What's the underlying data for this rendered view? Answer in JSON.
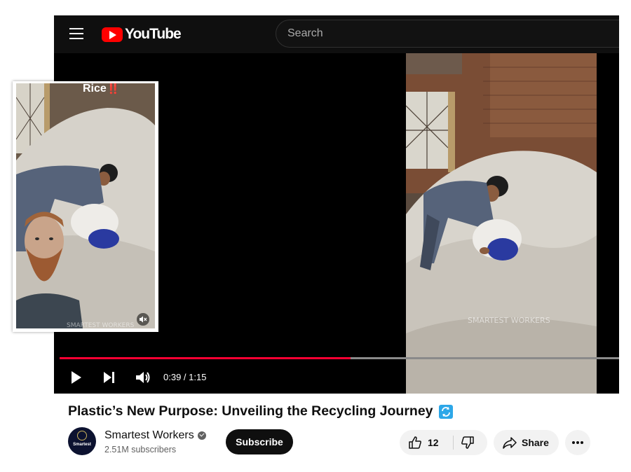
{
  "header": {
    "logo_text": "YouTube",
    "search_placeholder": "Search"
  },
  "player": {
    "current_time": "0:39",
    "duration": "1:15",
    "time_display": "0:39 / 1:15",
    "progress_fraction": 0.52,
    "progress_color": "#ff0033"
  },
  "overlay_clip": {
    "caption": "Rice‼️"
  },
  "video": {
    "title": "Plastic’s New Purpose: Unveiling the Recycling Journey"
  },
  "channel": {
    "name": "Smartest Workers",
    "subscribers": "2.51M subscribers",
    "avatar_text": "Smartest",
    "subscribe_label": "Subscribe"
  },
  "actions": {
    "like_count": "12",
    "share_label": "Share"
  },
  "icons": [
    "menu-icon",
    "youtube-logo-icon",
    "play-icon",
    "next-icon",
    "volume-icon",
    "mute-icon",
    "sync-icon",
    "verified-icon",
    "thumbs-up-icon",
    "thumbs-down-icon",
    "share-icon",
    "more-icon"
  ]
}
